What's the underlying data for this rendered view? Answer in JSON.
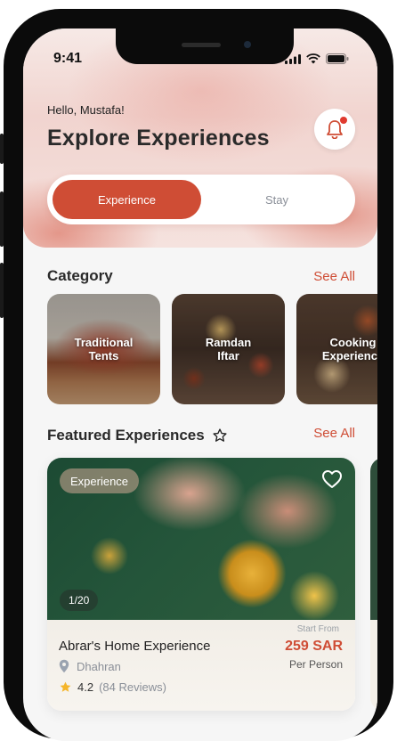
{
  "status_bar": {
    "time": "9:41"
  },
  "header": {
    "greeting": "Hello, Mustafa!",
    "title": "Explore Experiences"
  },
  "toggle": {
    "options": [
      "Experience",
      "Stay"
    ],
    "selected": "Experience"
  },
  "category": {
    "title": "Category",
    "see_all": "See All",
    "items": [
      {
        "label": "Traditional\nTents"
      },
      {
        "label": "Ramdan\nIftar"
      },
      {
        "label": "Cooking\nExperience"
      }
    ]
  },
  "featured": {
    "title": "Featured Experiences",
    "see_all": "See All",
    "card": {
      "badge": "Experience",
      "counter": "1/20",
      "name": "Abrar's Home Experience",
      "location": "Dhahran",
      "rating": "4.2",
      "reviews": "(84 Reviews)",
      "start_from": "Start From",
      "price": "259 SAR",
      "per": "Per Person"
    }
  },
  "colors": {
    "accent": "#cf4d35",
    "star": "#f5b52a",
    "muted_text": "#8a8f98"
  }
}
